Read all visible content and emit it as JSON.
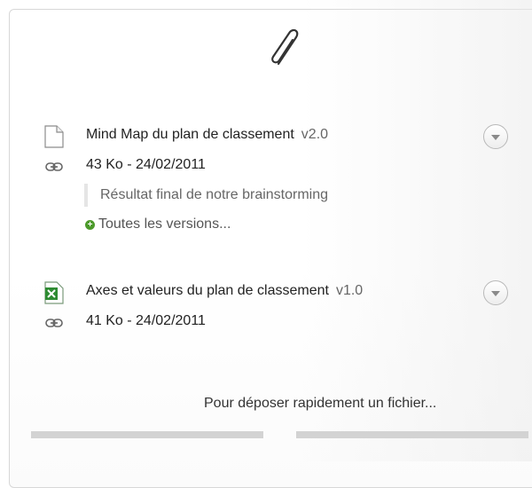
{
  "files": [
    {
      "title": "Mind Map du plan de classement",
      "version": "v2.0",
      "meta": "43 Ko - 24/02/2011",
      "comment": "Résultat final de notre brainstorming",
      "versions_link": "Toutes les versions...",
      "icon": "document-icon"
    },
    {
      "title": "Axes et valeurs du plan de classement",
      "version": "v1.0",
      "meta": "41 Ko - 24/02/2011",
      "icon": "excel-file-icon"
    }
  ],
  "upload": {
    "hint": "Pour déposer rapidement un fichier..."
  },
  "colors": {
    "excel_green": "#2e8b32",
    "plus_green": "#4c9a2a",
    "border": "#d7d7d7",
    "drop_bar": "#d3d3d3"
  }
}
